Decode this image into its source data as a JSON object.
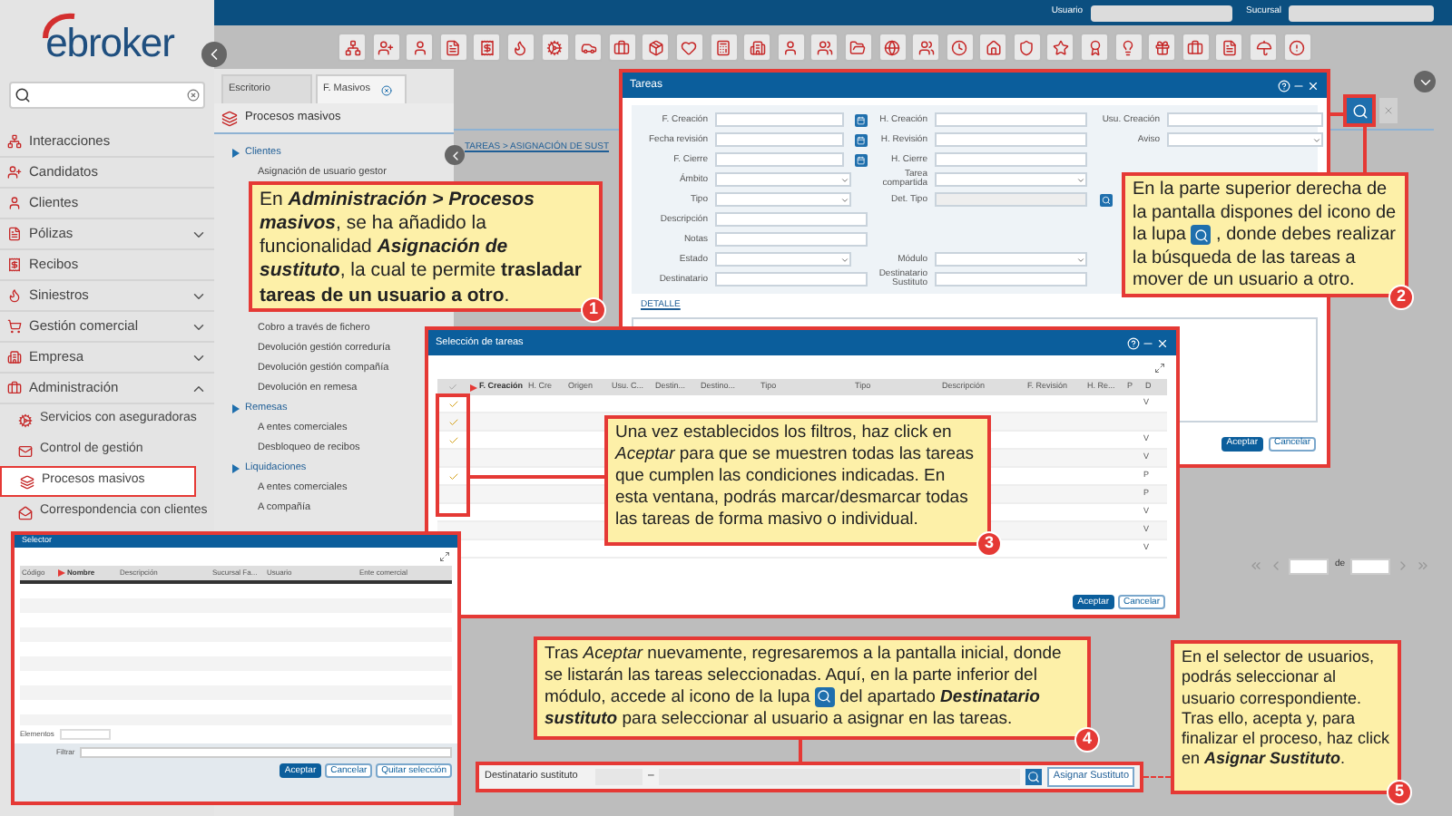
{
  "top_bar": {
    "user_label": "Usuario",
    "branch_label": "Sucursal"
  },
  "logo": "ebroker",
  "sidebar": {
    "items": [
      {
        "label": "Interacciones",
        "kind": "link"
      },
      {
        "label": "Candidatos",
        "kind": "link"
      },
      {
        "label": "Clientes",
        "kind": "link"
      },
      {
        "label": "Pólizas",
        "kind": "group",
        "expanded": false
      },
      {
        "label": "Recibos",
        "kind": "link"
      },
      {
        "label": "Siniestros",
        "kind": "group",
        "expanded": false
      },
      {
        "label": "Gestión comercial",
        "kind": "group",
        "expanded": false
      },
      {
        "label": "Empresa",
        "kind": "group",
        "expanded": false
      },
      {
        "label": "Administración",
        "kind": "group",
        "expanded": true,
        "children": [
          {
            "label": "Servicios con aseguradoras",
            "selected": false
          },
          {
            "label": "Control de gestión",
            "selected": false
          },
          {
            "label": "Procesos masivos",
            "selected": true
          },
          {
            "label": "Correspondencia con clientes",
            "selected": false
          }
        ]
      }
    ]
  },
  "tabs": [
    {
      "label": "Escritorio",
      "selected": false,
      "closable": false
    },
    {
      "label": "F. Masivos",
      "selected": true,
      "closable": true
    }
  ],
  "panel_title": "Procesos masivos",
  "tree": {
    "top": [
      {
        "label": "Clientes",
        "children": [
          {
            "label": "Asignación de usuario gestor"
          }
        ]
      }
    ],
    "bottom": [
      {
        "label": "Cobro a través de fichero"
      },
      {
        "label": "Devolución gestión correduría"
      },
      {
        "label": "Devolución gestión compañía"
      },
      {
        "label": "Devolución en remesa"
      },
      {
        "label": "Remesas",
        "children": [
          {
            "label": "A entes comerciales"
          },
          {
            "label": "Desbloqueo de recibos"
          }
        ]
      },
      {
        "label": "Liquidaciones",
        "children": [
          {
            "label": "A entes comerciales"
          },
          {
            "label": "A compañía"
          }
        ]
      }
    ]
  },
  "breadcrumb": "TAREAS > ASIGNACIÓN DE SUST",
  "pager": {
    "separator": "de"
  },
  "bottom_bar": {
    "label": "Destinatario sustituto",
    "dash": "–",
    "button": "Asignar Sustituto"
  },
  "tareas_window": {
    "title": "Tareas",
    "rows": [
      [
        {
          "label": "F. Creación",
          "kind": "date"
        },
        {
          "label": "H. Creación",
          "kind": "text"
        },
        {
          "label": "Usu. Creación",
          "kind": "text"
        }
      ],
      [
        {
          "label": "Fecha revisión",
          "kind": "date"
        },
        {
          "label": "H. Revisión",
          "kind": "text"
        },
        {
          "label": "Aviso",
          "kind": "select"
        }
      ],
      [
        {
          "label": "F. Cierre",
          "kind": "date"
        },
        {
          "label": "H. Cierre",
          "kind": "text"
        }
      ],
      [
        {
          "label": "Ámbito",
          "kind": "select"
        },
        {
          "label": "Tarea compartida",
          "kind": "select"
        }
      ],
      [
        {
          "label": "Tipo",
          "kind": "select"
        },
        {
          "label": "Det. Tipo",
          "kind": "search"
        }
      ],
      [
        {
          "label": "Descripción",
          "kind": "wide"
        }
      ],
      [
        {
          "label": "Notas",
          "kind": "wide"
        }
      ],
      [
        {
          "label": "Estado",
          "kind": "select"
        },
        {
          "label": "Módulo",
          "kind": "select"
        }
      ],
      [
        {
          "label": "Destinatario",
          "kind": "text"
        },
        {
          "label": "Destinatario Sustituto",
          "kind": "text"
        }
      ]
    ],
    "section": "DETALLE",
    "buttons": [
      {
        "label": "Aceptar",
        "kind": "primary"
      },
      {
        "label": "Cancelar",
        "kind": "secondary"
      }
    ]
  },
  "seleccion_window": {
    "title": "Selección de tareas",
    "columns": [
      {
        "label": "F. Creación",
        "required": true
      },
      {
        "label": "H. Cre",
        "required": false
      },
      {
        "label": "Origen",
        "required": false
      },
      {
        "label": "Usu. C...",
        "required": false
      },
      {
        "label": "Destin...",
        "required": false
      },
      {
        "label": "Destino...",
        "required": false
      },
      {
        "label": "Tipo",
        "required": false
      },
      {
        "label": "Tipo",
        "required": false
      },
      {
        "label": "Descripción",
        "required": false
      },
      {
        "label": "F. Revisión",
        "required": false
      },
      {
        "label": "H. Re...",
        "required": false
      },
      {
        "label": "P",
        "required": false
      },
      {
        "label": "D",
        "required": false
      }
    ],
    "rows": [
      {
        "checked": true,
        "flag": "V"
      },
      {
        "checked": true
      },
      {
        "checked": true,
        "flag": "V"
      },
      {
        "checked": false,
        "flag": "V"
      },
      {
        "checked": true,
        "flag": "P"
      },
      {
        "checked": false,
        "flag": "P"
      },
      {
        "checked": false,
        "flag": "V"
      },
      {
        "checked": false,
        "flag": "V"
      },
      {
        "flag": "V"
      }
    ],
    "buttons": [
      {
        "label": "Aceptar",
        "kind": "primary"
      },
      {
        "label": "Cancelar",
        "kind": "secondary"
      }
    ]
  },
  "selector_window": {
    "title": "Selector",
    "columns": [
      {
        "label": "Código",
        "required": false
      },
      {
        "label": "Nombre",
        "required": true
      },
      {
        "label": "Descripción",
        "required": false
      },
      {
        "label": "Sucursal Fa...",
        "required": false
      },
      {
        "label": "Usuario",
        "required": false
      },
      {
        "label": "Ente comercial",
        "required": false
      }
    ],
    "elements_label": "Elementos",
    "filter_label": "Filtrar",
    "buttons": [
      {
        "label": "Aceptar",
        "kind": "primary"
      },
      {
        "label": "Cancelar",
        "kind": "secondary"
      },
      {
        "label": "Quitar selección",
        "kind": "secondary"
      }
    ]
  },
  "callouts": [
    {
      "number": "1",
      "parts": [
        {
          "kind": "text",
          "text": "En "
        },
        {
          "kind": "emphasis",
          "text": "Administración >  Procesos masivos"
        },
        {
          "kind": "text",
          "text": ", se ha añadido la funcionalidad "
        },
        {
          "kind": "emphasis",
          "text": "Asignación de sustituto"
        },
        {
          "kind": "text",
          "text": ", la cual te permite **trasladar tareas de un usuario a otro**."
        }
      ]
    },
    {
      "number": "2",
      "parts": [
        {
          "kind": "text",
          "text": "En la parte superior derecha de la pantalla dispones del icono de la lupa "
        },
        {
          "kind": "icon"
        },
        {
          "kind": "text",
          "text": " , donde debes realizar la búsqueda de las tareas a mover de un usuario a otro."
        }
      ]
    },
    {
      "number": "3",
      "parts": [
        {
          "kind": "text",
          "text": "Una vez establecidos los filtros, haz click en *Aceptar* para que se muestren todas las tareas que cumplen las condiciones indicadas. En esta ventana, podrás marcar/desmarcar todas las tareas de forma masivo o individual."
        }
      ]
    },
    {
      "number": "4",
      "parts": [
        {
          "kind": "text",
          "text": "Tras *Aceptar* nuevamente, regresaremos a la pantalla inicial, donde se listarán las tareas seleccionadas. Aquí, en la parte inferior del módulo, accede al icono de la lupa "
        },
        {
          "kind": "icon"
        },
        {
          "kind": "text",
          "text": " del apartado "
        },
        {
          "kind": "emphasis",
          "text": "Destinatario sustituto"
        },
        {
          "kind": "text",
          "text": " para seleccionar al usuario a asignar en las tareas."
        }
      ]
    },
    {
      "number": "5",
      "parts": [
        {
          "kind": "text",
          "text": "En el selector de usuarios, podrás seleccionar  al usuario correspondiente. Tras ello, acepta y, para finalizar el proceso, haz click en "
        },
        {
          "kind": "emphasis",
          "text": "Asignar Sustituto"
        },
        {
          "kind": "text",
          "text": "."
        }
      ]
    }
  ]
}
